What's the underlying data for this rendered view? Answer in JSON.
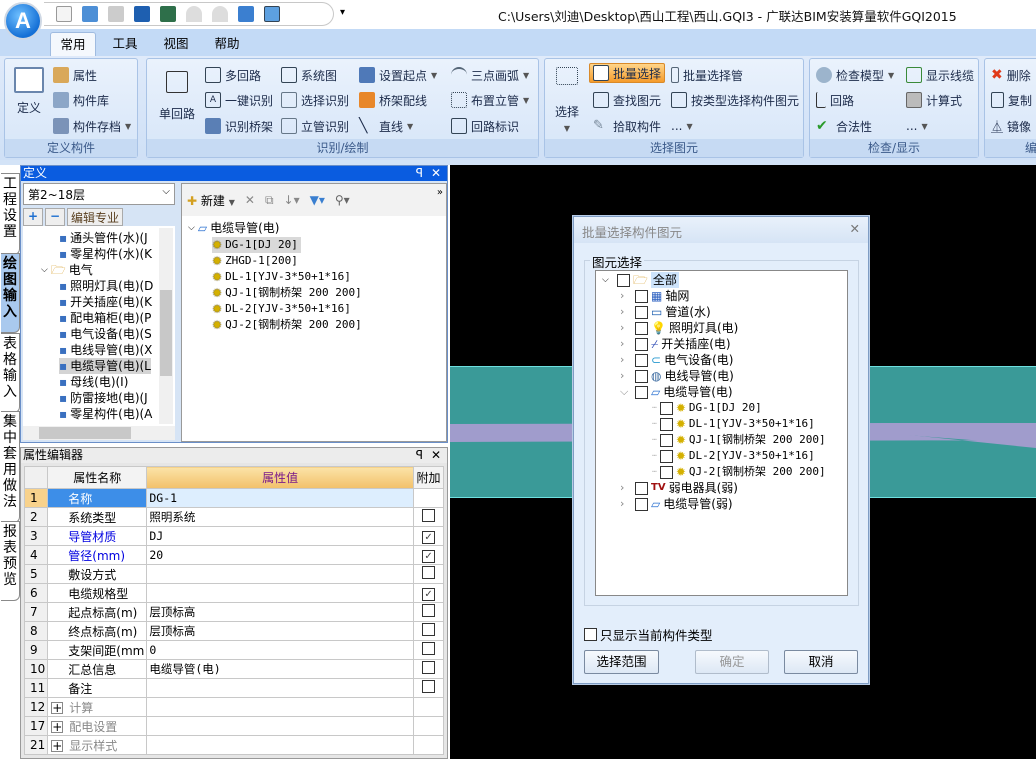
{
  "window": {
    "title": "C:\\Users\\刘迪\\Desktop\\西山工程\\西山.GQI3 - 广联达BIM安装算量软件GQI2015",
    "logo": "A"
  },
  "tabs": [
    "常用",
    "工具",
    "视图",
    "帮助"
  ],
  "ribbon": {
    "define": {
      "label": "定义构件",
      "big": "定义",
      "items": [
        "属性",
        "构件库",
        "构件存档"
      ]
    },
    "draw": {
      "label": "识别/绘制",
      "big": "单回路",
      "col1": [
        "多回路",
        "一键识别",
        "识别桥架"
      ],
      "col2": [
        "系统图",
        "选择识别",
        "立管识别"
      ],
      "col3": [
        "设置起点",
        "桥架配线",
        "直线"
      ],
      "col4": [
        "三点画弧",
        "布置立管",
        "回路标识"
      ]
    },
    "select": {
      "label": "选择图元",
      "big": "选择",
      "col1": [
        "批量选择",
        "查找图元",
        "拾取构件"
      ],
      "col2": [
        "批量选择管",
        "按类型选择构件图元",
        "..."
      ]
    },
    "check": {
      "label": "检查/显示",
      "col1": [
        "检查模型",
        "回路",
        "合法性"
      ],
      "col2": [
        "显示线缆",
        "计算式",
        "..."
      ]
    },
    "edit": {
      "label": "编",
      "items": [
        "删除",
        "复制",
        "镜像"
      ]
    }
  },
  "vtabs": [
    "工程设置",
    "绘图输入",
    "表格输入",
    "集中套用做法",
    "报表预览"
  ],
  "define_panel": {
    "title": "定义",
    "floor": "第2~18层",
    "edit_specialty": "编辑专业",
    "tree": [
      {
        "label": "通头管件(水)(J",
        "indent": 2
      },
      {
        "label": "零星构件(水)(K",
        "indent": 2
      },
      {
        "label": "电气",
        "indent": 1,
        "folder": true
      },
      {
        "label": "照明灯具(电)(D",
        "indent": 2
      },
      {
        "label": "开关插座(电)(K",
        "indent": 2
      },
      {
        "label": "配电箱柜(电)(P",
        "indent": 2
      },
      {
        "label": "电气设备(电)(S",
        "indent": 2
      },
      {
        "label": "电线导管(电)(X",
        "indent": 2
      },
      {
        "label": "电缆导管(电)(L",
        "indent": 2,
        "selected": true
      },
      {
        "label": "母线(电)(I)",
        "indent": 2
      },
      {
        "label": "防雷接地(电)(J",
        "indent": 2
      },
      {
        "label": "零星构件(电)(A",
        "indent": 2
      }
    ],
    "toolbar": {
      "new": "新建"
    },
    "list_root": "电缆导管(电)",
    "list": [
      "DG-1[DJ 20]",
      "ZHGD-1[200]",
      "DL-1[YJV-3*50+1*16]",
      "QJ-1[钢制桥架 200 200]",
      "DL-2[YJV-3*50+1*16]",
      "QJ-2[钢制桥架 200 200]"
    ]
  },
  "property_panel": {
    "title": "属性编辑器",
    "headers": [
      "属性名称",
      "属性值",
      "附加"
    ],
    "rows": [
      {
        "no": "1",
        "name": "名称",
        "value": "DG-1",
        "check": null,
        "style": "selected"
      },
      {
        "no": "2",
        "name": "系统类型",
        "value": "照明系统",
        "check": false
      },
      {
        "no": "3",
        "name": "导管材质",
        "value": "DJ",
        "check": true,
        "style": "blue"
      },
      {
        "no": "4",
        "name": "管径(mm)",
        "value": "20",
        "check": true,
        "style": "blue"
      },
      {
        "no": "5",
        "name": "敷设方式",
        "value": "",
        "check": false
      },
      {
        "no": "6",
        "name": "电缆规格型",
        "value": "",
        "check": true
      },
      {
        "no": "7",
        "name": "起点标高(m)",
        "value": "层顶标高",
        "check": false
      },
      {
        "no": "8",
        "name": "终点标高(m)",
        "value": "层顶标高",
        "check": false
      },
      {
        "no": "9",
        "name": "支架间距(mm",
        "value": "0",
        "check": false
      },
      {
        "no": "10",
        "name": "汇总信息",
        "value": "电缆导管(电)",
        "check": false
      },
      {
        "no": "11",
        "name": "备注",
        "value": "",
        "check": false
      },
      {
        "no": "12",
        "name": "计算",
        "value": "",
        "check": null,
        "style": "group"
      },
      {
        "no": "17",
        "name": "配电设置",
        "value": "",
        "check": null,
        "style": "group"
      },
      {
        "no": "21",
        "name": "显示样式",
        "value": "",
        "check": null,
        "style": "group"
      }
    ]
  },
  "dialog": {
    "title": "批量选择构件图元",
    "group": "图元选择",
    "root": "全部",
    "nodes": [
      {
        "label": "轴网",
        "level": 1,
        "expand": ">",
        "icon": "grid"
      },
      {
        "label": "管道(水)",
        "level": 1,
        "expand": ">",
        "icon": "pipe"
      },
      {
        "label": "照明灯具(电)",
        "level": 1,
        "expand": ">",
        "icon": "bulb"
      },
      {
        "label": "开关插座(电)",
        "level": 1,
        "expand": ">",
        "icon": "switch"
      },
      {
        "label": "电气设备(电)",
        "level": 1,
        "expand": ">",
        "icon": "device"
      },
      {
        "label": "电线导管(电)",
        "level": 1,
        "expand": ">",
        "icon": "wire"
      },
      {
        "label": "电缆导管(电)",
        "level": 1,
        "expand": "v",
        "icon": "cable"
      },
      {
        "label": "DG-1[DJ 20]",
        "level": 2,
        "icon": "gear"
      },
      {
        "label": "DL-1[YJV-3*50+1*16]",
        "level": 2,
        "icon": "gear"
      },
      {
        "label": "QJ-1[钢制桥架 200 200]",
        "level": 2,
        "icon": "gear"
      },
      {
        "label": "DL-2[YJV-3*50+1*16]",
        "level": 2,
        "icon": "gear"
      },
      {
        "label": "QJ-2[钢制桥架 200 200]",
        "level": 2,
        "icon": "gear"
      },
      {
        "label": "弱电器具(弱)",
        "level": 1,
        "expand": ">",
        "icon": "tv"
      },
      {
        "label": "电缆导管(弱)",
        "level": 1,
        "expand": ">",
        "icon": "cable"
      }
    ],
    "only_current": "只显示当前构件类型",
    "select_range": "选择范围",
    "ok": "确定",
    "cancel": "取消"
  },
  "colors": {
    "accent": "#0a5ce0",
    "teal": "#3a9a98",
    "lavender": "#a09ccc",
    "highlight": "#f59b2c"
  }
}
